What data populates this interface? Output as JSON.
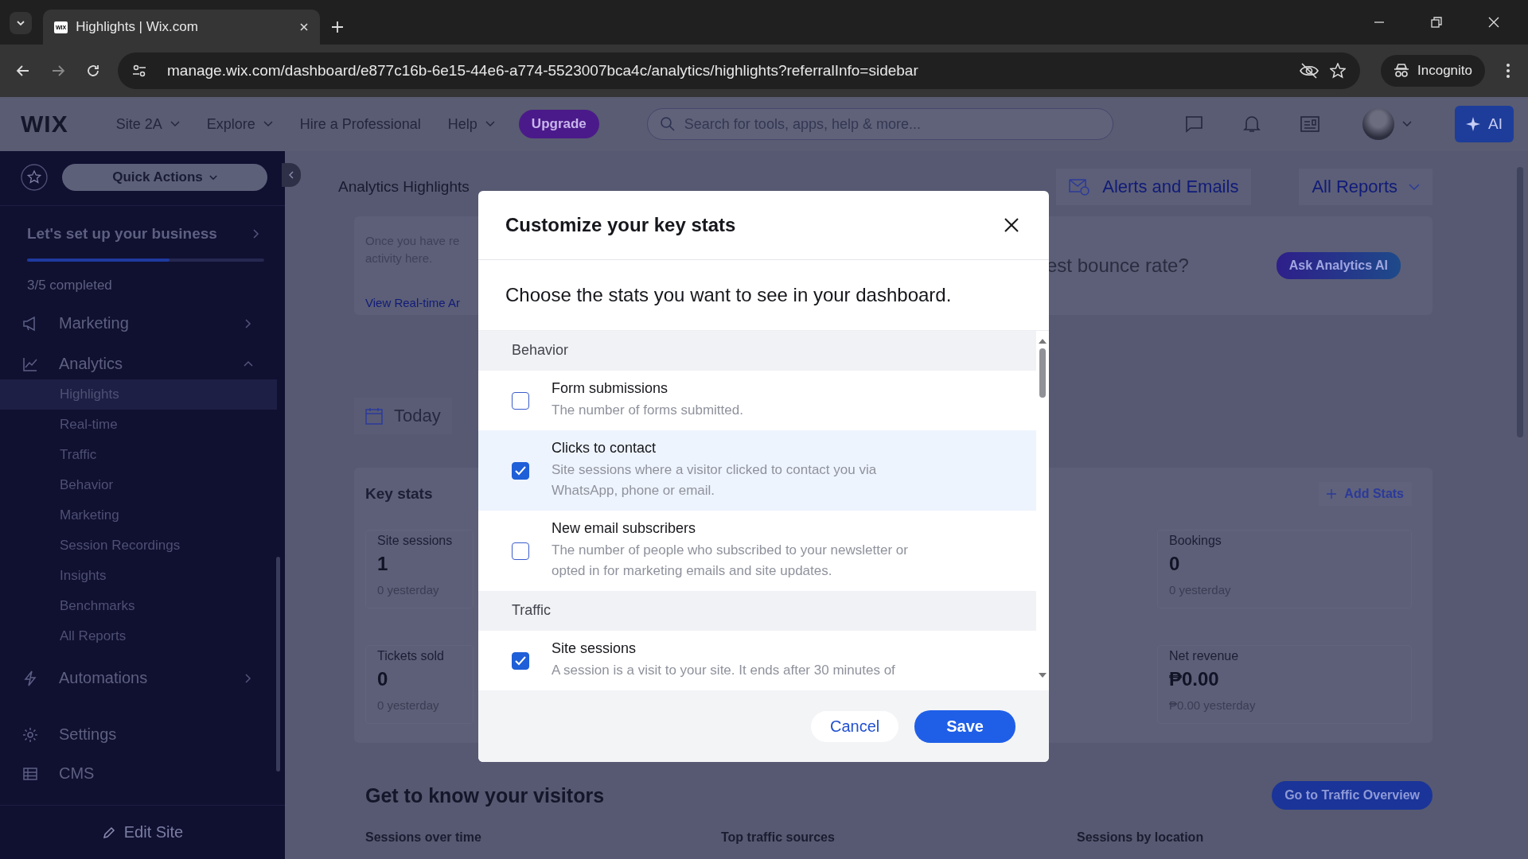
{
  "browser": {
    "tab_title": "Highlights | Wix.com",
    "favicon": "WIX",
    "url": "manage.wix.com/dashboard/e877c16b-6e15-44e6-a774-5523007bca4c/analytics/highlights?referralInfo=sidebar",
    "profile": "Incognito"
  },
  "topbar": {
    "logo": "WIX",
    "nav": [
      {
        "label": "Site 2A",
        "dropdown": true
      },
      {
        "label": "Explore",
        "dropdown": true
      },
      {
        "label": "Hire a Professional",
        "dropdown": false
      },
      {
        "label": "Help",
        "dropdown": true
      }
    ],
    "upgrade": "Upgrade",
    "search_placeholder": "Search for tools, apps, help & more...",
    "ai_label": "AI"
  },
  "sidebar": {
    "quick_actions": "Quick Actions",
    "setup": {
      "title": "Let's set up your business",
      "level": 0.6,
      "progress": "3/5 completed"
    },
    "items": [
      {
        "label": "Marketing",
        "expanded": false
      },
      {
        "label": "Analytics",
        "expanded": true,
        "children": [
          {
            "label": "Highlights",
            "selected": true
          },
          {
            "label": "Real-time",
            "selected": false
          },
          {
            "label": "Traffic",
            "selected": false
          },
          {
            "label": "Behavior",
            "selected": false
          },
          {
            "label": "Marketing",
            "selected": false
          },
          {
            "label": "Session Recordings",
            "selected": false
          },
          {
            "label": "Insights",
            "selected": false
          },
          {
            "label": "Benchmarks",
            "selected": false
          },
          {
            "label": "All Reports",
            "selected": false
          }
        ]
      },
      {
        "label": "Automations",
        "expanded": false
      },
      {
        "label": "Settings"
      },
      {
        "label": "CMS"
      }
    ],
    "edit_site": "Edit Site"
  },
  "main": {
    "title": "Analytics Highlights",
    "alerts": "Alerts and Emails",
    "all_reports": "All Reports",
    "intro": {
      "lines": [
        "Once you have re",
        "activity here."
      ],
      "link": "View Real-time Ar",
      "question": "est bounce rate?",
      "ask_button": "Ask Analytics AI"
    },
    "date": "Today",
    "key_stats": {
      "title": "Key stats",
      "add_label": "Add Stats",
      "stats": [
        {
          "name": "Site sessions",
          "value": "1",
          "yesterday": "0 yesterday"
        },
        {
          "name": "Bookings",
          "value": "0",
          "yesterday": "0 yesterday"
        },
        {
          "name": "Tickets sold",
          "value": "0",
          "yesterday": "0 yesterday"
        },
        {
          "name": "Net revenue",
          "value": "₱0.00",
          "yesterday": "₱0.00 yesterday"
        }
      ]
    },
    "visitors": {
      "title": "Get to know your visitors",
      "button": "Go to Traffic Overview",
      "columns": [
        "Sessions over time",
        "Top traffic sources",
        "Sessions by location"
      ]
    }
  },
  "dialog": {
    "title": "Customize your key stats",
    "subtitle": "Choose the stats you want to see in your dashboard.",
    "sections": [
      {
        "title": "Behavior",
        "items": [
          {
            "label": "Form submissions",
            "description": "The number of forms submitted.",
            "checked": false,
            "highlighted": false
          },
          {
            "label": "Clicks to contact",
            "description": "Site sessions where a visitor clicked to contact you via WhatsApp, phone or email.",
            "checked": true,
            "highlighted": true
          },
          {
            "label": "New email subscribers",
            "description": "The number of people who subscribed to your newsletter or opted in for marketing emails and site updates.",
            "checked": false,
            "highlighted": false
          }
        ]
      },
      {
        "title": "Traffic",
        "items": [
          {
            "label": "Site sessions",
            "description": "A session is a visit to your site. It ends after 30 minutes of",
            "checked": true,
            "highlighted": false
          }
        ]
      }
    ],
    "cancel": "Cancel",
    "save": "Save"
  }
}
